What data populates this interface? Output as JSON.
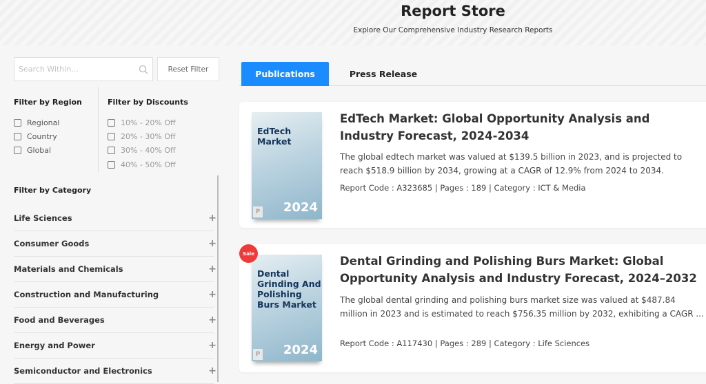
{
  "header": {
    "title": "Report Store",
    "subtitle": "Explore Our Comprehensive Industry Research Reports"
  },
  "sidebar": {
    "search_placeholder": "Search Within...",
    "reset_label": "Reset Filter",
    "region": {
      "heading": "Filter by Region",
      "options": [
        "Regional",
        "Country",
        "Global"
      ]
    },
    "discounts": {
      "heading": "Filter by Discounts",
      "options": [
        "10% - 20% Off",
        "20% - 30% Off",
        "30% - 40% Off",
        "40% - 50% Off"
      ]
    },
    "category": {
      "heading": "Filter by Category",
      "items": [
        "Life Sciences",
        "Consumer Goods",
        "Materials and Chemicals",
        "Construction and Manufacturing",
        "Food and Beverages",
        "Energy and Power",
        "Semiconductor and Electronics"
      ],
      "expand_symbol": "+"
    }
  },
  "tabs": [
    {
      "label": "Publications",
      "active": true
    },
    {
      "label": "Press Release",
      "active": false
    }
  ],
  "reports": [
    {
      "cover_title": "EdTech Market",
      "cover_year": "2024",
      "cover_badge": "P",
      "title": "EdTech Market: Global Opportunity Analysis and Industry Forecast, 2024-2034",
      "description": "The global edtech market was valued at $139.5 billion in 2023, and is projected to reach $518.9 billion by 2034, growing at a CAGR of 12.9% from 2024 to 2034.",
      "meta": "Report Code : A323685 | Pages : 189 | Category : ICT & Media"
    },
    {
      "sale": "Sale",
      "cover_title": "Dental Grinding And Polishing Burs Market",
      "cover_year": "2024",
      "cover_badge": "P",
      "title": "Dental Grinding and Polishing Burs Market: Global Opportunity Analysis and Industry Forecast, 2024–2032",
      "description": "The global dental grinding and polishing burs market size was valued at $487.84 million in 2023 and is estimated to reach $756.35 million by 2032, exhibiting a CAGR ...",
      "meta": "Report Code : A117430 | Pages : 289 | Category : Life Sciences"
    }
  ],
  "colors": {
    "accent": "#1a8cff",
    "sale": "#ef3a3a"
  }
}
